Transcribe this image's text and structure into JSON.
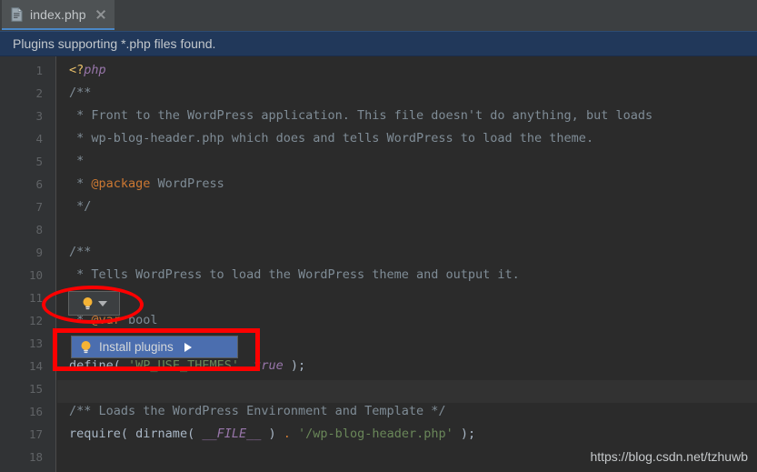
{
  "window": {
    "app_kind": "php-ide-editor",
    "background": "#3c3f41"
  },
  "tabbar": {
    "tabs": [
      {
        "label": "index.php",
        "file_icon": "php-file-icon",
        "close_icon": "close-icon",
        "active": true
      }
    ]
  },
  "notification": {
    "text": "Plugins supporting *.php files found.",
    "background": "#21385a",
    "text_color": "#c3c8cc"
  },
  "editor": {
    "background": "#2b2b2b",
    "gutter_background": "#313335",
    "line_numbers": [
      "1",
      "2",
      "3",
      "4",
      "5",
      "6",
      "7",
      "8",
      "9",
      "10",
      "11",
      "12",
      "13",
      "14",
      "15",
      "16",
      "17",
      "18"
    ],
    "lines": [
      {
        "n": 1,
        "text": "<?php"
      },
      {
        "n": 2,
        "text": "/**"
      },
      {
        "n": 3,
        "text": " * Front to the WordPress application. This file doesn't do anything, but loads"
      },
      {
        "n": 4,
        "text": " * wp-blog-header.php which does and tells WordPress to load the theme."
      },
      {
        "n": 5,
        "text": " *"
      },
      {
        "n": 6,
        "text": " * @package WordPress"
      },
      {
        "n": 7,
        "text": " */"
      },
      {
        "n": 8,
        "text": ""
      },
      {
        "n": 9,
        "text": "/**"
      },
      {
        "n": 10,
        "text": " * Tells WordPress to load the WordPress theme and output it."
      },
      {
        "n": 11,
        "text": " *"
      },
      {
        "n": 12,
        "text": " * @var bool"
      },
      {
        "n": 13,
        "text": " */"
      },
      {
        "n": 14,
        "text": "define( 'WP_USE_THEMES', true );"
      },
      {
        "n": 15,
        "text": ""
      },
      {
        "n": 16,
        "text": "/** Loads the WordPress Environment and Template */"
      },
      {
        "n": 17,
        "text": "require( dirname( __FILE__ ) . '/wp-blog-header.php' );"
      },
      {
        "n": 18,
        "text": ""
      }
    ]
  },
  "intention_button": {
    "icon": "lightbulb-icon",
    "dropdown_icon": "chevron-down-icon",
    "tooltip": ""
  },
  "intention_popup": {
    "items": [
      {
        "label": "Install plugins",
        "icon": "lightbulb-icon",
        "submenu_icon": "submenu-arrow-icon",
        "selected": true,
        "background": "#4b6eaf"
      }
    ]
  },
  "annotations": {
    "ellipse": {
      "color": "#fe0000",
      "target": "intention-bulb-button"
    },
    "rectangle": {
      "color": "#fe0000",
      "target": "intention-popup"
    }
  },
  "watermark": {
    "text": "https://blog.csdn.net/tzhuwb"
  }
}
